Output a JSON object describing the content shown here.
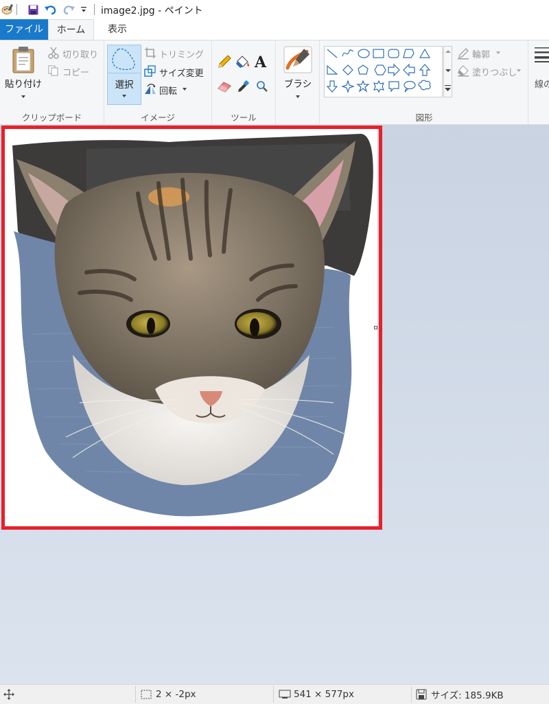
{
  "window": {
    "title": "image2.jpg - ペイント"
  },
  "tabs": {
    "file": "ファイル",
    "home": "ホーム",
    "view": "表示"
  },
  "ribbon": {
    "clipboard": {
      "paste": "貼り付け",
      "cut": "切り取り",
      "copy": "コピー",
      "label": "クリップボード"
    },
    "image": {
      "select": "選択",
      "crop": "トリミング",
      "resize": "サイズ変更",
      "rotate": "回転",
      "label": "イメージ"
    },
    "tools": {
      "label": "ツール"
    },
    "brush": {
      "label": "ブラシ"
    },
    "shapes": {
      "outline": "輪郭",
      "fill": "塗りつぶし",
      "label": "図形"
    },
    "line_width": {
      "label": "線の"
    }
  },
  "statusbar": {
    "cursor_pos": "2 × -2px",
    "image_size": "541 × 577px",
    "file_size": "サイズ: 185.9KB"
  },
  "colors": {
    "accent": "#1979ca",
    "highlight": "#e8202a",
    "select_bg": "#cce4f7"
  }
}
